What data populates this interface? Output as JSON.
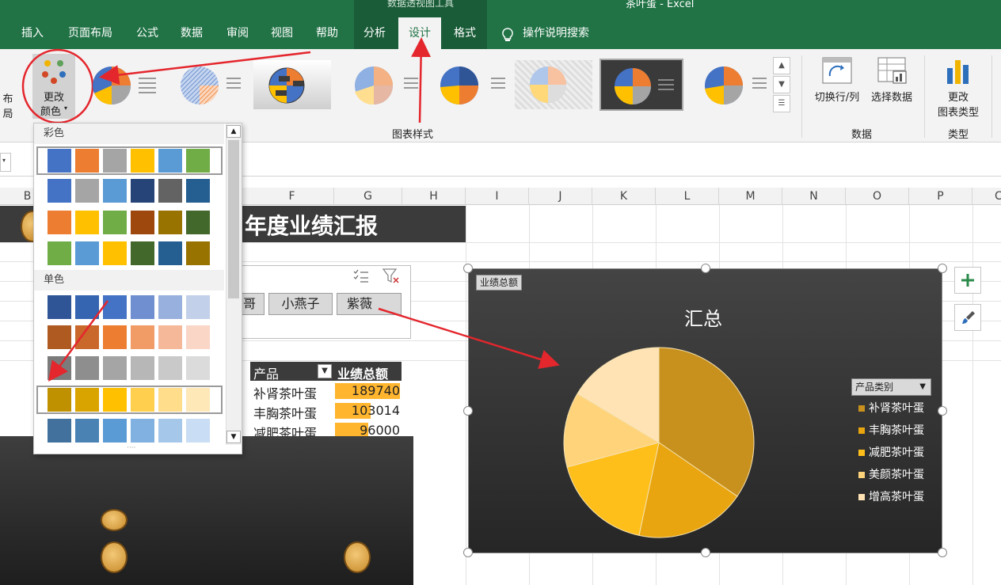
{
  "app": {
    "context_group": "数据透视图工具",
    "document_title": "茶叶蛋 - Excel"
  },
  "tabs": [
    "插入",
    "页面布局",
    "公式",
    "数据",
    "审阅",
    "视图",
    "帮助",
    "分析",
    "设计",
    "格式"
  ],
  "active_tab": "设计",
  "tell_me": "操作说明搜索",
  "ribbon": {
    "left_partial": "布局",
    "change_colors_line1": "更改",
    "change_colors_line2": "颜色",
    "chart_styles_group": "图表样式",
    "switch_row_col": "切换行/列",
    "select_data": "选择数据",
    "data_group": "数据",
    "change_type_line1": "更改",
    "change_type_line2": "图表类型",
    "type_group": "类型"
  },
  "columns": [
    "B",
    "F",
    "G",
    "H",
    "I",
    "J",
    "K",
    "L",
    "M",
    "N",
    "O",
    "P",
    "C"
  ],
  "sheet": {
    "banner_title": "年度业绩汇报",
    "slicer_items": [
      "哥",
      "小燕子",
      "紫薇"
    ],
    "pivot": {
      "header_product": "产品",
      "header_total": "业绩总额",
      "rows": [
        {
          "product": "补肾茶叶蛋",
          "total": "189740",
          "ratio": 1.0
        },
        {
          "product": "丰胸茶叶蛋",
          "total": "103014",
          "ratio": 0.54
        },
        {
          "product": "减肥茶叶蛋",
          "total": "96000",
          "ratio": 0.51
        }
      ]
    }
  },
  "palette": {
    "colorful_label": "彩色",
    "mono_label": "单色",
    "colorful_rows": [
      [
        "#4472c4",
        "#ed7d31",
        "#a5a5a5",
        "#ffc000",
        "#5b9bd5",
        "#70ad47"
      ],
      [
        "#4472c4",
        "#a5a5a5",
        "#5b9bd5",
        "#264478",
        "#636363",
        "#255e91"
      ],
      [
        "#ed7d31",
        "#ffc000",
        "#70ad47",
        "#9e480e",
        "#997300",
        "#43682b"
      ],
      [
        "#70ad47",
        "#5b9bd5",
        "#ffc000",
        "#43682b",
        "#255e91",
        "#997300"
      ]
    ],
    "mono_rows": [
      [
        "#2f5597",
        "#3564b0",
        "#4472c4",
        "#6f8fd0",
        "#98b0dd",
        "#c2d0ea"
      ],
      [
        "#ae5a21",
        "#c9682a",
        "#ed7d31",
        "#f19b66",
        "#f5b99a",
        "#f9d6c6"
      ],
      [
        "#7b7b7b",
        "#8e8e8e",
        "#a5a5a5",
        "#b7b7b7",
        "#c9c9c9",
        "#dbdbdb"
      ],
      [
        "#bf9000",
        "#d9a300",
        "#ffc000",
        "#ffcf4d",
        "#ffdd8a",
        "#ffe8b8"
      ],
      [
        "#41719c",
        "#4a82b4",
        "#5b9bd5",
        "#80b1e0",
        "#a5c7ea",
        "#c9ddf4"
      ]
    ]
  },
  "chart": {
    "tag": "业绩总额",
    "title": "汇总",
    "legend_header": "产品类别",
    "legend": [
      {
        "name": "补肾茶叶蛋",
        "color": "#c8911e"
      },
      {
        "name": "丰胸茶叶蛋",
        "color": "#e8a50f"
      },
      {
        "name": "减肥茶叶蛋",
        "color": "#ffbf1a"
      },
      {
        "name": "美颜茶叶蛋",
        "color": "#ffd37a"
      },
      {
        "name": "增高茶叶蛋",
        "color": "#ffe3b5"
      }
    ]
  },
  "chart_data": {
    "type": "pie",
    "title": "汇总",
    "categories": [
      "补肾茶叶蛋",
      "丰胸茶叶蛋",
      "减肥茶叶蛋",
      "美颜茶叶蛋",
      "增高茶叶蛋"
    ],
    "values": [
      189740,
      103014,
      96000,
      70000,
      90000
    ],
    "legend": "right"
  }
}
